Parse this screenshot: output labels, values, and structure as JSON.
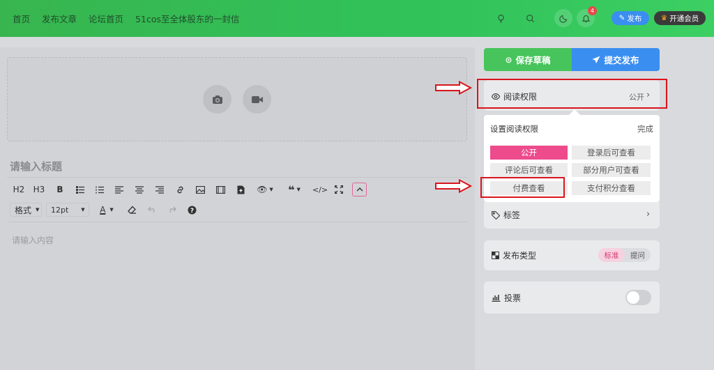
{
  "nav": {
    "items": [
      "首页",
      "发布文章",
      "论坛首页",
      "51cos至全体股东的一封信"
    ]
  },
  "header": {
    "notification_count": "4",
    "publish_label": "发布",
    "vip_label": "开通会员"
  },
  "editor": {
    "title_placeholder": "请输入标题",
    "content_placeholder": "请输入内容",
    "toolbar": {
      "h2": "H2",
      "h3": "H3",
      "bold": "B",
      "format_label": "格式",
      "font_size": "12pt",
      "font_color_label": "A"
    }
  },
  "sidebar": {
    "save_draft_label": "保存草稿",
    "submit_label": "提交发布",
    "read_permission": {
      "label": "阅读权限",
      "value": "公开"
    },
    "popup": {
      "title": "设置阅读权限",
      "done_label": "完成",
      "options": [
        "公开",
        "登录后可查看",
        "评论后可查看",
        "部分用户可查看",
        "付费查看",
        "支付积分查看"
      ],
      "selected": "公开"
    },
    "tags_label": "标签",
    "publish_type": {
      "label": "发布类型",
      "options": [
        "标准",
        "提问"
      ],
      "selected": "标准"
    },
    "vote": {
      "label": "投票",
      "enabled": false
    }
  },
  "colors": {
    "header_green": "#38b54f",
    "save_green": "#47c45b",
    "submit_blue": "#3a8ef0",
    "accent_pink": "#ed4b8c",
    "annotation_red": "#d9141c"
  }
}
